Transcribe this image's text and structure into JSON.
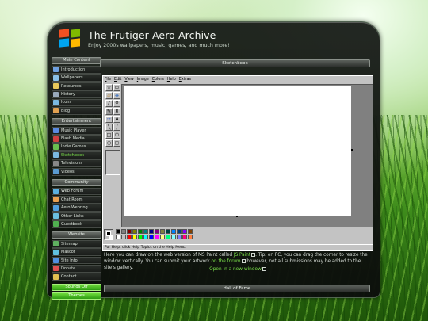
{
  "site": {
    "title": "The Frutiger Aero Archive",
    "subtitle": "Enjoy 2000s wallpapers, music, games, and much more!"
  },
  "sidebar": {
    "groups": [
      {
        "heading": "Main Content",
        "items": [
          {
            "label": "Introduction",
            "icon": "home-icon",
            "color": "#6fa0e0"
          },
          {
            "label": "Wallpapers",
            "icon": "picture-icon",
            "color": "#8ac0e8"
          },
          {
            "label": "Resources",
            "icon": "folder-icon",
            "color": "#e8c85a"
          },
          {
            "label": "History",
            "icon": "clock-icon",
            "color": "#9ab"
          },
          {
            "label": "Icons",
            "icon": "grid-icon",
            "color": "#7ab8e0"
          },
          {
            "label": "Blog",
            "icon": "pen-icon",
            "color": "#e0a050"
          }
        ]
      },
      {
        "heading": "Entertainment",
        "items": [
          {
            "label": "Music Player",
            "icon": "music-icon",
            "color": "#5a8ae0"
          },
          {
            "label": "Flash Media",
            "icon": "flash-icon",
            "color": "#d04040"
          },
          {
            "label": "Indie Games",
            "icon": "gamepad-icon",
            "color": "#6ac050"
          },
          {
            "label": "Sketchbook",
            "icon": "paint-icon",
            "color": "#7ab8e0",
            "active": true
          },
          {
            "label": "Televisions",
            "icon": "tv-icon",
            "color": "#888"
          },
          {
            "label": "Videos",
            "icon": "video-icon",
            "color": "#5a9ad0"
          }
        ]
      },
      {
        "heading": "Community",
        "items": [
          {
            "label": "Web Forum",
            "icon": "forum-icon",
            "color": "#5ab0e0"
          },
          {
            "label": "Chat Room",
            "icon": "chat-icon",
            "color": "#e8a050"
          },
          {
            "label": "Aero Webring",
            "icon": "globe-icon",
            "color": "#50a0e0"
          },
          {
            "label": "Other Links",
            "icon": "link-icon",
            "color": "#6ac0e0"
          },
          {
            "label": "Guestbook",
            "icon": "book-icon",
            "color": "#50b050"
          }
        ]
      },
      {
        "heading": "Website",
        "items": [
          {
            "label": "Sitemap",
            "icon": "map-icon",
            "color": "#60b060"
          },
          {
            "label": "Mascot",
            "icon": "mascot-icon",
            "color": "#60c0e0"
          },
          {
            "label": "Site Info",
            "icon": "info-icon",
            "color": "#5090e0"
          },
          {
            "label": "Donate",
            "icon": "heart-icon",
            "color": "#e05050"
          },
          {
            "label": "Contact",
            "icon": "mail-icon",
            "color": "#e0c050"
          }
        ]
      }
    ],
    "buttons": {
      "sounds": "Sounds Off",
      "themes": "Themes"
    }
  },
  "panel": {
    "title": "Sketchbook",
    "bottom_title": "Hall of Fame"
  },
  "paint": {
    "menus": [
      {
        "u": "F",
        "rest": "ile"
      },
      {
        "u": "E",
        "rest": "dit"
      },
      {
        "u": "V",
        "rest": "iew"
      },
      {
        "u": "I",
        "rest": "mage"
      },
      {
        "u": "C",
        "rest": "olors"
      },
      {
        "u": "H",
        "rest": "elp"
      },
      {
        "u": "E",
        "rest": "xtras"
      }
    ],
    "status": "For Help, click Help Topics on the Help Menu.",
    "palette_top": [
      "#000000",
      "#808080",
      "#800000",
      "#808000",
      "#008000",
      "#008080",
      "#000080",
      "#800080",
      "#808040",
      "#004040",
      "#0080ff",
      "#004080",
      "#8000ff",
      "#804000"
    ],
    "palette_bottom": [
      "#ffffff",
      "#c0c0c0",
      "#ff0000",
      "#ffff00",
      "#00ff00",
      "#00ffff",
      "#0000ff",
      "#ff00ff",
      "#ffff80",
      "#00ff80",
      "#80ffff",
      "#8080ff",
      "#ff0080",
      "#ff8040"
    ]
  },
  "description": {
    "p1": "Here you can draw on the web version of MS Paint called ",
    "link1": "JS Paint",
    "p2": ". Tip: on PC, you can drag the corner to resize the window vertically. You can submit your artwork ",
    "link2": "on the forum",
    "p3": " however, not all submissions may be added to the site's gallery.",
    "open_link": "Open in a new window"
  }
}
